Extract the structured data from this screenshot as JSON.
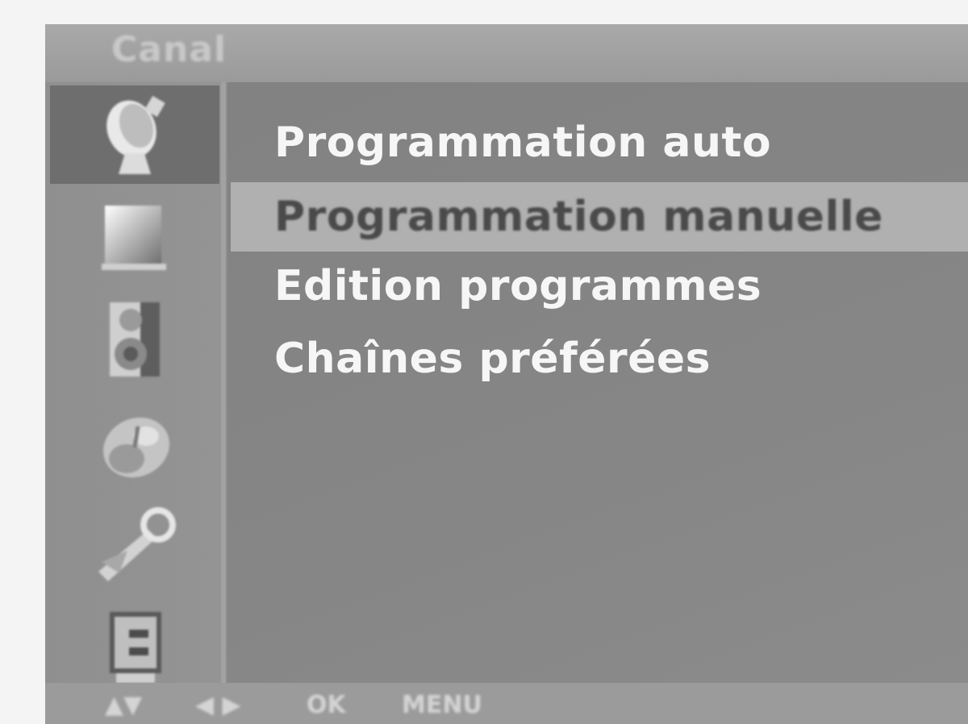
{
  "header": {
    "title": "Canal"
  },
  "sidebar": {
    "items": [
      {
        "icon": "satellite-dish-icon",
        "active": true
      },
      {
        "icon": "picture-icon",
        "active": false
      },
      {
        "icon": "speaker-icon",
        "active": false
      },
      {
        "icon": "clock-icon",
        "active": false
      },
      {
        "icon": "wrench-icon",
        "active": false
      },
      {
        "icon": "lock-icon",
        "active": false
      }
    ]
  },
  "menu": {
    "items": [
      {
        "label": "Programmation auto",
        "selected": false
      },
      {
        "label": "Programmation manuelle",
        "selected": true
      },
      {
        "label": "Edition programmes",
        "selected": false
      },
      {
        "label": "Chaînes préférées",
        "selected": false
      }
    ]
  },
  "footer": {
    "nav_updown": "▲▼",
    "nav_leftright": "◀ ▶",
    "ok": "OK",
    "menu": "MENU"
  },
  "colors": {
    "selected_bar": "#b0b0b0",
    "active_icon_bg": "#6e6e6e",
    "text": "#f6f6f6"
  }
}
